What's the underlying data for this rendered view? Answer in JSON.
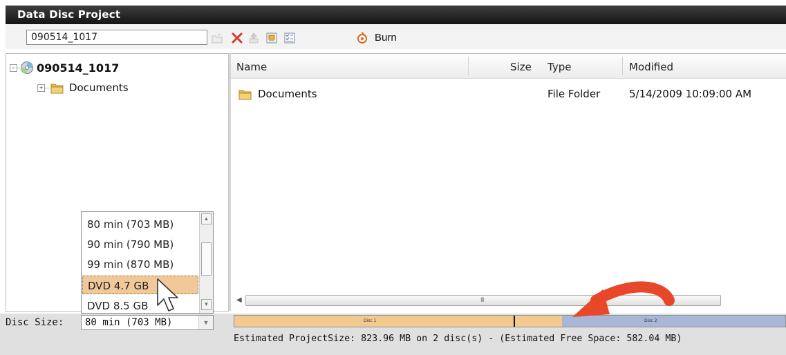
{
  "window": {
    "title": "Data Disc Project"
  },
  "toolbar": {
    "project_name": "090514_1017",
    "burn_label": "Burn",
    "icons": [
      "new-folder-icon",
      "delete-icon",
      "move-up-icon",
      "properties-icon",
      "checklist-icon",
      "burn-icon"
    ]
  },
  "tree": {
    "root": {
      "label": "090514_1017",
      "icon": "disc-icon",
      "expander": "−"
    },
    "children": [
      {
        "label": "Documents",
        "icon": "folder-icon",
        "expander": "+"
      }
    ]
  },
  "file_list": {
    "columns": {
      "name": "Name",
      "size": "Size",
      "type": "Type",
      "modified": "Modified"
    },
    "rows": [
      {
        "name": "Documents",
        "size": "",
        "type": "File Folder",
        "modified": "5/14/2009 10:09:00 AM"
      }
    ],
    "scroll_grip": "III"
  },
  "disc_size": {
    "label": "Disc Size:",
    "selected": "80 min (703 MB)",
    "options": [
      "80 min (703 MB)",
      "90 min (790 MB)",
      "99 min (870 MB)",
      "DVD 4.7 GB",
      "DVD 8.5 GB"
    ],
    "highlighted": "DVD 4.7 GB"
  },
  "capacity": {
    "disc1_label": "Disc 1",
    "disc2_label": "Disc 2",
    "disc1_fraction": 0.595,
    "marker_fraction": 0.507,
    "colors": {
      "disc1": "#f2c98f",
      "disc2": "#a9b7d6"
    }
  },
  "status": {
    "text": "Estimated ProjectSize: 823.96 MB on 2 disc(s) - (Estimated Free Space: 582.04 MB)"
  },
  "colors": {
    "annotation_arrow": "#e8472a",
    "titlebar": "#2b2b2b",
    "selection": "#f1c898"
  }
}
